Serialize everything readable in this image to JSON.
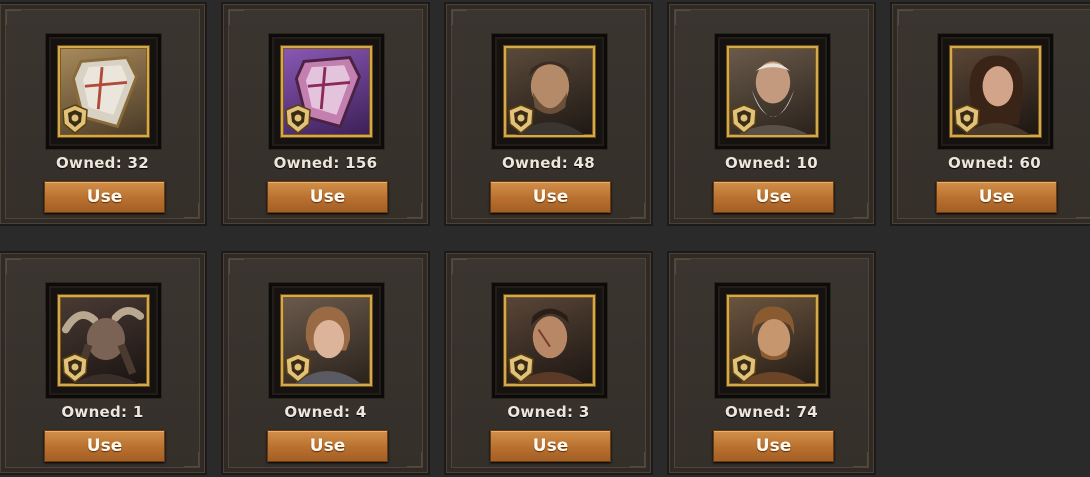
{
  "items": [
    {
      "id": "shield-gold",
      "owned": "Owned: 32",
      "use_label": "Use",
      "portrait_icon": "shield-icon",
      "rarity_color": "#c7a77a"
    },
    {
      "id": "shield-purple",
      "owned": "Owned: 156",
      "use_label": "Use",
      "portrait_icon": "shield-icon",
      "rarity_color": "#6b3b8c"
    },
    {
      "id": "hero-bearded-man",
      "owned": "Owned: 48",
      "use_label": "Use",
      "portrait_icon": "hero-portrait-icon",
      "rarity_color": "#c7a77a"
    },
    {
      "id": "hero-old-wizard",
      "owned": "Owned: 10",
      "use_label": "Use",
      "portrait_icon": "hero-portrait-icon",
      "rarity_color": "#c7a77a"
    },
    {
      "id": "hero-dark-haired-woman",
      "owned": "Owned: 60",
      "use_label": "Use",
      "portrait_icon": "hero-portrait-icon",
      "rarity_color": "#c7a77a"
    },
    {
      "id": "hero-horned-beast",
      "owned": "Owned: 1",
      "use_label": "Use",
      "portrait_icon": "hero-portrait-icon",
      "rarity_color": "#c7a77a"
    },
    {
      "id": "hero-red-haired-woman",
      "owned": "Owned: 4",
      "use_label": "Use",
      "portrait_icon": "hero-portrait-icon",
      "rarity_color": "#c7a77a"
    },
    {
      "id": "hero-scarred-man",
      "owned": "Owned: 3",
      "use_label": "Use",
      "portrait_icon": "hero-portrait-icon",
      "rarity_color": "#c7a77a"
    },
    {
      "id": "hero-young-man",
      "owned": "Owned: 74",
      "use_label": "Use",
      "portrait_icon": "hero-portrait-icon",
      "rarity_color": "#c7a77a"
    }
  ],
  "colors": {
    "button": "#b9702f",
    "frame_gold": "#d4a94c",
    "background": "#2a2a2a"
  }
}
